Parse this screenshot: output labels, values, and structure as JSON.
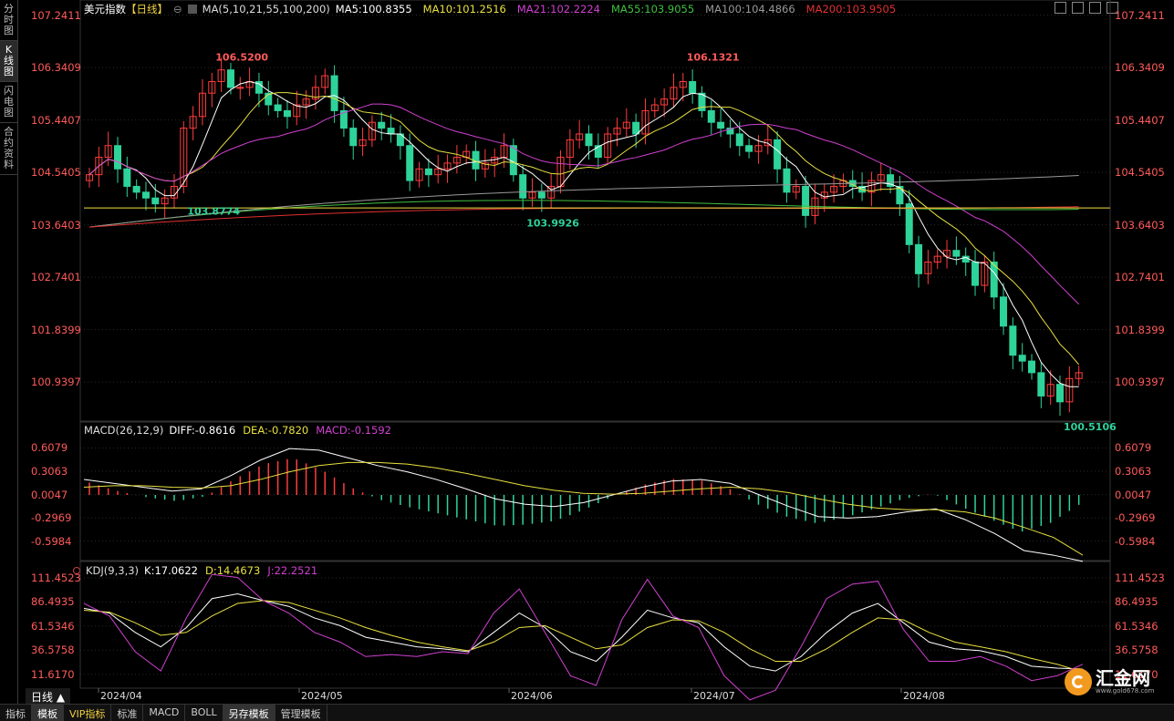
{
  "sidebar": {
    "tabs": [
      {
        "label": "分时图",
        "active": false
      },
      {
        "label": "K线图",
        "active": true
      },
      {
        "label": "闪电图",
        "active": false
      },
      {
        "label": "合约资料",
        "active": false
      }
    ]
  },
  "main_legend": {
    "title": "美元指数",
    "period_tag": "【日线】",
    "ma_label": "MA(5,10,21,55,100,200)",
    "items": [
      {
        "text": "MA5:100.8355",
        "color": "#ffffff"
      },
      {
        "text": "MA10:101.2516",
        "color": "#e8e040"
      },
      {
        "text": "MA21:102.2224",
        "color": "#d040d0"
      },
      {
        "text": "MA55:103.9055",
        "color": "#40c040"
      },
      {
        "text": "MA100:104.4866",
        "color": "#999999"
      },
      {
        "text": "MA200:103.9505",
        "color": "#e03030"
      }
    ]
  },
  "macd_legend": {
    "label": "MACD(26,12,9)",
    "items": [
      {
        "text": "DIFF:-0.8616",
        "color": "#ffffff"
      },
      {
        "text": "DEA:-0.7820",
        "color": "#e8e040"
      },
      {
        "text": "MACD:-0.1592",
        "color": "#d040d0"
      }
    ]
  },
  "kdj_legend": {
    "label": "KDJ(9,3,3)",
    "items": [
      {
        "text": "K:17.0622",
        "color": "#ffffff"
      },
      {
        "text": "D:14.4673",
        "color": "#e8e040"
      },
      {
        "text": "J:22.2521",
        "color": "#d040d0"
      }
    ]
  },
  "bottom_bar": {
    "period_label": "日线 ▲",
    "tabs": [
      {
        "label": "指标",
        "active": false
      },
      {
        "label": "模板",
        "active": true
      },
      {
        "label": "VIP指标",
        "vip": true
      },
      {
        "label": "标准"
      },
      {
        "label": "MACD"
      },
      {
        "label": "BOLL"
      },
      {
        "label": "另存模板",
        "active": true
      },
      {
        "label": "管理模板"
      }
    ]
  },
  "logo": {
    "name": "汇金网",
    "url": "www.gold678.com"
  },
  "colors": {
    "up": "#ff3c3c",
    "down": "#2ed39a",
    "price_axis": "#ff5a5a",
    "grid": "#2a2a2a"
  },
  "chart_data": [
    {
      "type": "candlestick",
      "title": "美元指数【日线】",
      "ylim": [
        100.3,
        107.25
      ],
      "y_ticks": [
        "107.2411",
        "106.3409",
        "105.4407",
        "104.5405",
        "103.6403",
        "102.7401",
        "101.8399",
        "100.9397"
      ],
      "x_ticks": [
        "2024/04",
        "2024/05",
        "2024/06",
        "2024/07",
        "2024/08"
      ],
      "horizontal_line": 103.93,
      "annotations": [
        {
          "text": "106.5200",
          "kind": "high",
          "color": "#ff5a5a"
        },
        {
          "text": "103.8774",
          "kind": "low",
          "color": "#2ed39a"
        },
        {
          "text": "103.9926",
          "kind": "low",
          "color": "#2ed39a"
        },
        {
          "text": "106.1321",
          "kind": "high",
          "color": "#ff5a5a"
        },
        {
          "text": "100.5106",
          "kind": "low",
          "color": "#2ed39a"
        }
      ],
      "close": [
        104.5,
        104.8,
        105.0,
        104.6,
        104.3,
        104.2,
        104.1,
        104.0,
        104.1,
        104.3,
        105.3,
        105.5,
        105.9,
        106.1,
        106.3,
        106.0,
        106.0,
        106.1,
        105.9,
        105.7,
        105.6,
        105.5,
        105.7,
        105.8,
        106.0,
        106.2,
        105.6,
        105.3,
        105.0,
        105.1,
        105.4,
        105.3,
        105.2,
        105.0,
        104.4,
        104.6,
        104.5,
        104.6,
        104.7,
        104.8,
        104.9,
        104.6,
        104.7,
        104.8,
        105.0,
        104.5,
        104.1,
        104.2,
        104.1,
        104.3,
        104.8,
        105.1,
        105.2,
        105.0,
        104.8,
        105.2,
        105.3,
        105.4,
        105.2,
        105.6,
        105.7,
        105.8,
        106.0,
        106.1,
        105.9,
        105.6,
        105.4,
        105.3,
        105.2,
        105.0,
        104.9,
        105.0,
        105.1,
        104.6,
        104.2,
        104.3,
        103.8,
        104.1,
        104.2,
        104.3,
        104.4,
        104.3,
        104.2,
        104.4,
        104.5,
        104.3,
        104.0,
        103.3,
        102.8,
        103.0,
        103.1,
        103.2,
        103.1,
        103.0,
        102.6,
        103.0,
        102.4,
        101.9,
        101.4,
        101.3,
        101.1,
        100.7,
        100.9,
        100.6,
        101.0,
        101.1
      ],
      "ma_series": [
        "MA5",
        "MA10",
        "MA21",
        "MA55",
        "MA100",
        "MA200"
      ]
    },
    {
      "type": "line",
      "title": "MACD(26,12,9)",
      "ylim": [
        -0.85,
        0.72
      ],
      "y_ticks": [
        "0.6079",
        "0.3063",
        "0.0047",
        "-0.2969",
        "-0.5984"
      ],
      "series": [
        {
          "name": "DIFF",
          "values": [
            0.2,
            0.15,
            0.1,
            0.05,
            0.08,
            0.25,
            0.45,
            0.6,
            0.58,
            0.48,
            0.38,
            0.3,
            0.2,
            0.08,
            -0.05,
            -0.12,
            -0.15,
            -0.1,
            0.0,
            0.1,
            0.18,
            0.2,
            0.15,
            0.0,
            -0.15,
            -0.28,
            -0.3,
            -0.28,
            -0.22,
            -0.18,
            -0.32,
            -0.5,
            -0.72,
            -0.78,
            -0.86
          ]
        },
        {
          "name": "DEA",
          "values": [
            0.1,
            0.12,
            0.12,
            0.1,
            0.09,
            0.12,
            0.2,
            0.3,
            0.38,
            0.42,
            0.42,
            0.4,
            0.35,
            0.28,
            0.2,
            0.12,
            0.06,
            0.02,
            0.01,
            0.02,
            0.05,
            0.08,
            0.1,
            0.08,
            0.03,
            -0.05,
            -0.12,
            -0.17,
            -0.19,
            -0.19,
            -0.22,
            -0.3,
            -0.42,
            -0.55,
            -0.78
          ]
        }
      ]
    },
    {
      "type": "line",
      "title": "KDJ(9,3,3)",
      "ylim": [
        0,
        120
      ],
      "y_ticks": [
        "111.4523",
        "86.4935",
        "61.5346",
        "36.5758",
        "11.6170"
      ],
      "series": [
        {
          "name": "K",
          "values": [
            80,
            75,
            55,
            40,
            60,
            90,
            95,
            88,
            82,
            70,
            62,
            50,
            45,
            40,
            38,
            35,
            55,
            75,
            60,
            35,
            25,
            50,
            78,
            70,
            65,
            40,
            20,
            15,
            30,
            55,
            75,
            85,
            65,
            45,
            38,
            36,
            30,
            20,
            18,
            17
          ]
        },
        {
          "name": "D",
          "values": [
            78,
            76,
            65,
            52,
            55,
            72,
            85,
            88,
            86,
            78,
            70,
            60,
            52,
            45,
            40,
            36,
            45,
            60,
            62,
            50,
            38,
            42,
            60,
            68,
            67,
            55,
            38,
            25,
            25,
            38,
            55,
            70,
            68,
            55,
            45,
            40,
            35,
            28,
            22,
            14
          ]
        },
        {
          "name": "J",
          "values": [
            85,
            72,
            35,
            15,
            70,
            115,
            112,
            88,
            75,
            55,
            45,
            30,
            32,
            30,
            35,
            33,
            75,
            100,
            55,
            10,
            0,
            68,
            110,
            72,
            60,
            10,
            -15,
            -5,
            40,
            90,
            105,
            108,
            58,
            25,
            25,
            30,
            20,
            5,
            10,
            22
          ]
        }
      ]
    }
  ]
}
